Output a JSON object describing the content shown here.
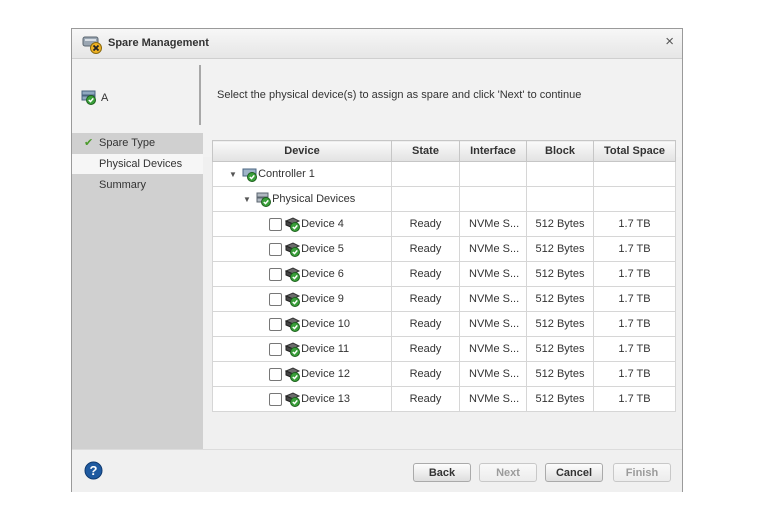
{
  "dialog": {
    "title": "Spare Management",
    "close_glyph": "×"
  },
  "object": {
    "label": "A",
    "icon": "array-icon"
  },
  "instruction": "Select the physical device(s) to assign as spare and click 'Next' to continue",
  "steps": [
    {
      "label": "Spare Type",
      "done": true
    },
    {
      "label": "Physical Devices",
      "active": true
    },
    {
      "label": "Summary"
    }
  ],
  "table": {
    "columns": [
      "Device",
      "State",
      "Interface",
      "Block",
      "Total Space"
    ],
    "controller": "Controller 1",
    "group": "Physical Devices",
    "devices": [
      {
        "name": "Device 4",
        "state": "Ready",
        "interface": "NVMe S...",
        "block": "512 Bytes",
        "space": "1.7 TB"
      },
      {
        "name": "Device 5",
        "state": "Ready",
        "interface": "NVMe S...",
        "block": "512 Bytes",
        "space": "1.7 TB"
      },
      {
        "name": "Device 6",
        "state": "Ready",
        "interface": "NVMe S...",
        "block": "512 Bytes",
        "space": "1.7 TB"
      },
      {
        "name": "Device 9",
        "state": "Ready",
        "interface": "NVMe S...",
        "block": "512 Bytes",
        "space": "1.7 TB"
      },
      {
        "name": "Device 10",
        "state": "Ready",
        "interface": "NVMe S...",
        "block": "512 Bytes",
        "space": "1.7 TB"
      },
      {
        "name": "Device 11",
        "state": "Ready",
        "interface": "NVMe S...",
        "block": "512 Bytes",
        "space": "1.7 TB"
      },
      {
        "name": "Device 12",
        "state": "Ready",
        "interface": "NVMe S...",
        "block": "512 Bytes",
        "space": "1.7 TB"
      },
      {
        "name": "Device 13",
        "state": "Ready",
        "interface": "NVMe S...",
        "block": "512 Bytes",
        "space": "1.7 TB"
      }
    ]
  },
  "buttons": {
    "back": "Back",
    "next": "Next",
    "cancel": "Cancel",
    "finish": "Finish"
  },
  "colors": {
    "check": "#4a9a2a",
    "help": "#1f5aa0",
    "sidebar": "#d0d0d0"
  }
}
